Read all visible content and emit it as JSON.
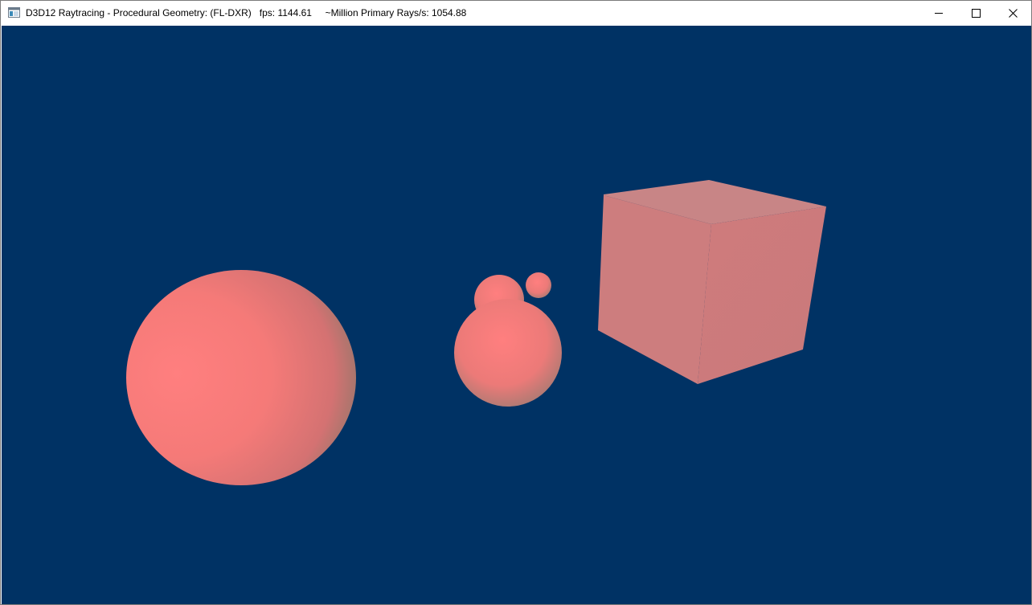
{
  "window": {
    "title": "D3D12 Raytracing - Procedural Geometry: (FL-DXR)",
    "fps": "fps: 1144.61",
    "rays": "~Million Primary Rays/s: 1054.88"
  },
  "icons": {
    "app": "app-window-icon",
    "minimize": "minimize-icon",
    "maximize": "maximize-icon",
    "close": "close-icon"
  },
  "colors": {
    "background": "#003264",
    "object": "#ff7f7f"
  }
}
